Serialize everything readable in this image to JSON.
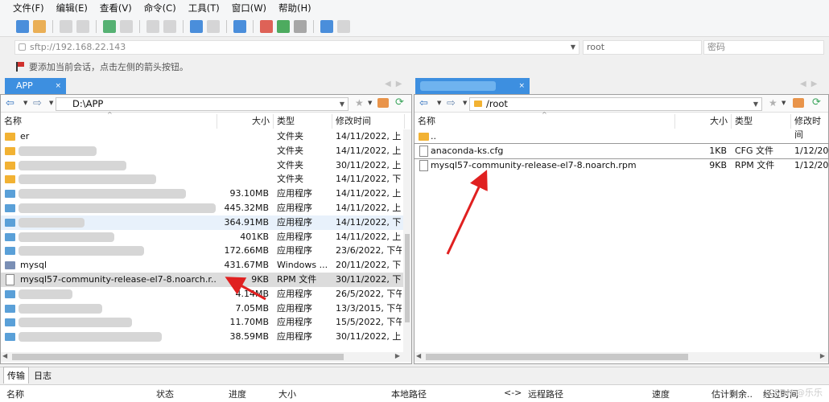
{
  "menu": [
    "文件(F)",
    "编辑(E)",
    "查看(V)",
    "命令(C)",
    "工具(T)",
    "窗口(W)",
    "帮助(H)"
  ],
  "toolbar_icons": [
    "new-session-icon",
    "open-folder-icon",
    "disconnect-icon",
    "reconnect-icon",
    "new-window-icon",
    "terminal-icon",
    "copy-icon",
    "paste-icon",
    "sync-icon",
    "settings-icon",
    "globe-icon",
    "download-icon",
    "upload-icon",
    "gear-icon",
    "help-icon",
    "chat-icon"
  ],
  "connection": {
    "host": "sftp://192.168.22.143",
    "user": "root",
    "password_placeholder": "密码"
  },
  "hint": "要添加当前会话，点击左侧的箭头按钮。",
  "left_tab": {
    "label": "APP",
    "close": "×"
  },
  "right_tab": {
    "label": "",
    "close": "×"
  },
  "left": {
    "path": "D:\\APP",
    "columns": [
      "名称",
      "大小",
      "类型",
      "修改时间"
    ],
    "rows": [
      {
        "name": "er",
        "size": "",
        "type": "文件夹",
        "modified": "14/11/2022, 上",
        "kind": "folder"
      },
      {
        "name": "",
        "size": "",
        "type": "文件夹",
        "modified": "14/11/2022, 上",
        "kind": "folder"
      },
      {
        "name": "",
        "size": "",
        "type": "文件夹",
        "modified": "30/11/2022, 上",
        "kind": "folder"
      },
      {
        "name": "",
        "size": "",
        "type": "文件夹",
        "modified": "14/11/2022, 下",
        "kind": "folder"
      },
      {
        "name": "",
        "size": "93.10MB",
        "type": "应用程序",
        "modified": "14/11/2022, 上",
        "kind": "app"
      },
      {
        "name": "",
        "size": "445.32MB",
        "type": "应用程序",
        "modified": "14/11/2022, 上",
        "kind": "app"
      },
      {
        "name": "",
        "size": "364.91MB",
        "type": "应用程序",
        "modified": "14/11/2022, 下",
        "kind": "app"
      },
      {
        "name": "",
        "size": "401KB",
        "type": "应用程序",
        "modified": "14/11/2022, 上",
        "kind": "app"
      },
      {
        "name": "",
        "size": "172.66MB",
        "type": "应用程序",
        "modified": "23/6/2022, 下午",
        "kind": "app"
      },
      {
        "name": "mysql",
        "size": "431.67MB",
        "type": "Windows ...",
        "modified": "20/11/2022, 下",
        "kind": "msi"
      },
      {
        "name": "mysql57-community-release-el7-8.noarch.r...",
        "size": "9KB",
        "type": "RPM 文件",
        "modified": "30/11/2022, 下",
        "kind": "file"
      },
      {
        "name": "",
        "size": "4.14MB",
        "type": "应用程序",
        "modified": "26/5/2022, 下午",
        "kind": "app"
      },
      {
        "name": "",
        "size": "7.05MB",
        "type": "应用程序",
        "modified": "13/3/2015, 下午",
        "kind": "app"
      },
      {
        "name": "",
        "size": "11.70MB",
        "type": "应用程序",
        "modified": "15/5/2022, 下午",
        "kind": "app"
      },
      {
        "name": "",
        "size": "38.59MB",
        "type": "应用程序",
        "modified": "30/11/2022, 上",
        "kind": "app"
      }
    ]
  },
  "right": {
    "path": "/root",
    "columns": [
      "名称",
      "大小",
      "类型",
      "修改时间"
    ],
    "rows": [
      {
        "name": "..",
        "size": "",
        "type": "",
        "modified": "",
        "kind": "folder"
      },
      {
        "name": "anaconda-ks.cfg",
        "size": "1KB",
        "type": "CFG 文件",
        "modified": "1/12/20",
        "kind": "file"
      },
      {
        "name": "mysql57-community-release-el7-8.noarch.rpm",
        "size": "9KB",
        "type": "RPM 文件",
        "modified": "1/12/20",
        "kind": "file"
      }
    ]
  },
  "bottom_tabs": [
    "传输",
    "日志"
  ],
  "transfer_columns": [
    "名称",
    "状态",
    "进度",
    "大小",
    "本地路径",
    "<->",
    "远程路径",
    "速度",
    "估计剩余..",
    "经过时间"
  ],
  "watermark": "CSDN @乐乐"
}
